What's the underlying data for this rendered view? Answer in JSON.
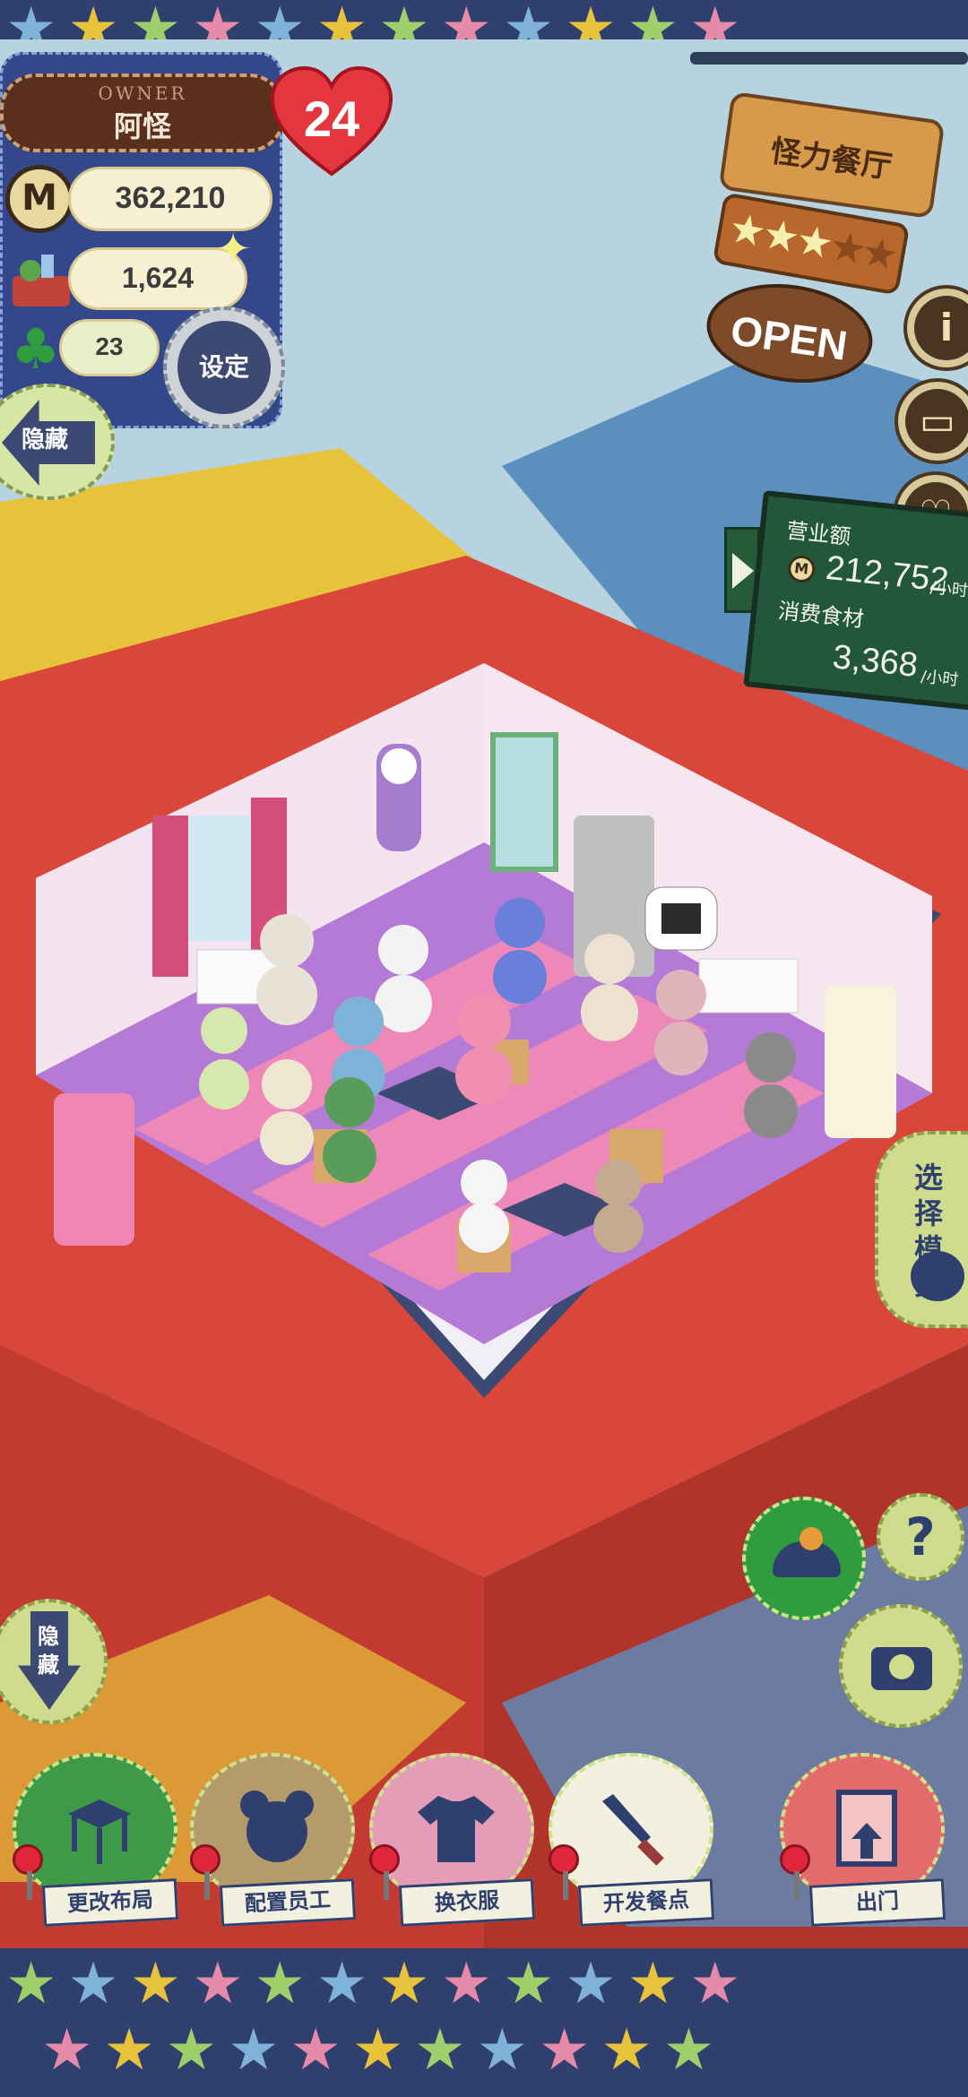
{
  "owner": {
    "caption": "OWNER",
    "name": "阿怪",
    "level": "24"
  },
  "resources": {
    "money": "362,210",
    "food": "1,624",
    "clover": "23"
  },
  "buttons": {
    "settings": "设定",
    "hide_top": "隐藏",
    "hide_bottom": "隐\n藏",
    "mode": "选择\n模式"
  },
  "restaurant": {
    "name": "怪力餐厅",
    "status": "OPEN",
    "star_rating": 3,
    "max_stars": 5
  },
  "revenue": {
    "label": "营业额",
    "value": "212,752",
    "unit": "/小时",
    "consumption_label": "消费食材",
    "consumption_value": "3,368",
    "consumption_unit": "/小时"
  },
  "toolbar": [
    {
      "label": "更改布局",
      "icon": "table-icon"
    },
    {
      "label": "配置员工",
      "icon": "bear-head-icon"
    },
    {
      "label": "换衣服",
      "icon": "shirt-icon"
    },
    {
      "label": "开发餐点",
      "icon": "knife-icon"
    },
    {
      "label": "出门",
      "icon": "door-icon"
    }
  ],
  "side_icons": [
    "info-icon",
    "book-icon",
    "heart-icon",
    "hat-icon",
    "help-icon",
    "camera-icon"
  ],
  "colors": {
    "navy": "#2f3f6e",
    "red_block": "#d9463a",
    "yellow_block": "#e7c33b",
    "blue_block": "#5b8fbe",
    "floor_purple": "#b47ad6",
    "floor_pink": "#ee88b9"
  }
}
